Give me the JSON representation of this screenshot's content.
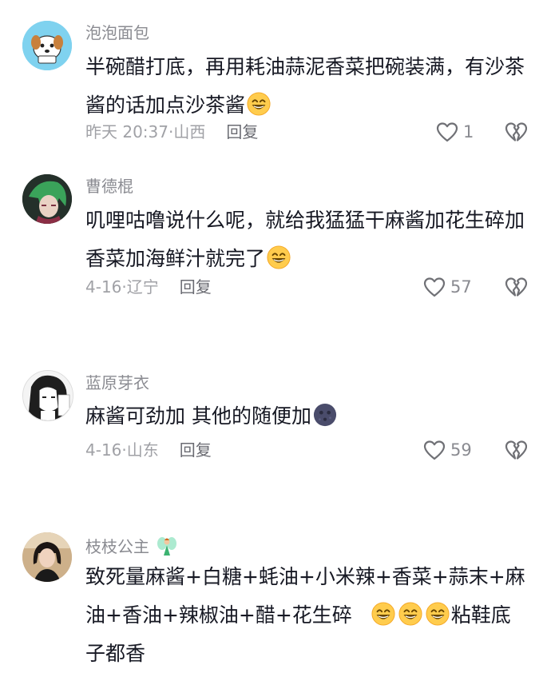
{
  "comments": [
    {
      "username": "泡泡面包",
      "text": "半碗醋打底，再用耗油蒜泥香菜把碗装满，有沙茶酱的话加点沙茶酱",
      "date": "昨天 20:37",
      "location": "山西",
      "likes": "1",
      "emoji_count": 1
    },
    {
      "username": "曹德棍",
      "text": "叽哩咕噜说什么呢，就给我猛猛干麻酱加花生碎加香菜加海鲜汁就完了",
      "date": "4-16",
      "location": "辽宁",
      "likes": "57",
      "emoji_count": 1
    },
    {
      "username": "蓝原芽衣",
      "text": "麻酱可劲加 其他的随便加",
      "date": "4-16",
      "location": "山东",
      "likes": "59",
      "emoji_count": 1
    },
    {
      "username": "枝枝公主",
      "text_line1": "致死量麻酱+白糖+蚝油+小米辣+香菜+蒜末+麻",
      "text_line2": "油+香油+辣椒油+醋+花生碎",
      "text_line3_suffix": "粘鞋底",
      "text_line4": "子都香",
      "emoji_count": 3
    }
  ],
  "reply_label": "回复",
  "meta_separator": "·",
  "icons": {
    "like": "heart-outline-icon",
    "dislike": "broken-heart-icon",
    "grin": "grinning-emoji",
    "moon": "new-moon-face-emoji",
    "fairy": "fairy-emoji"
  },
  "colors": {
    "name": "#8a8b91",
    "text": "#161823",
    "meta": "#a0a1a6"
  }
}
